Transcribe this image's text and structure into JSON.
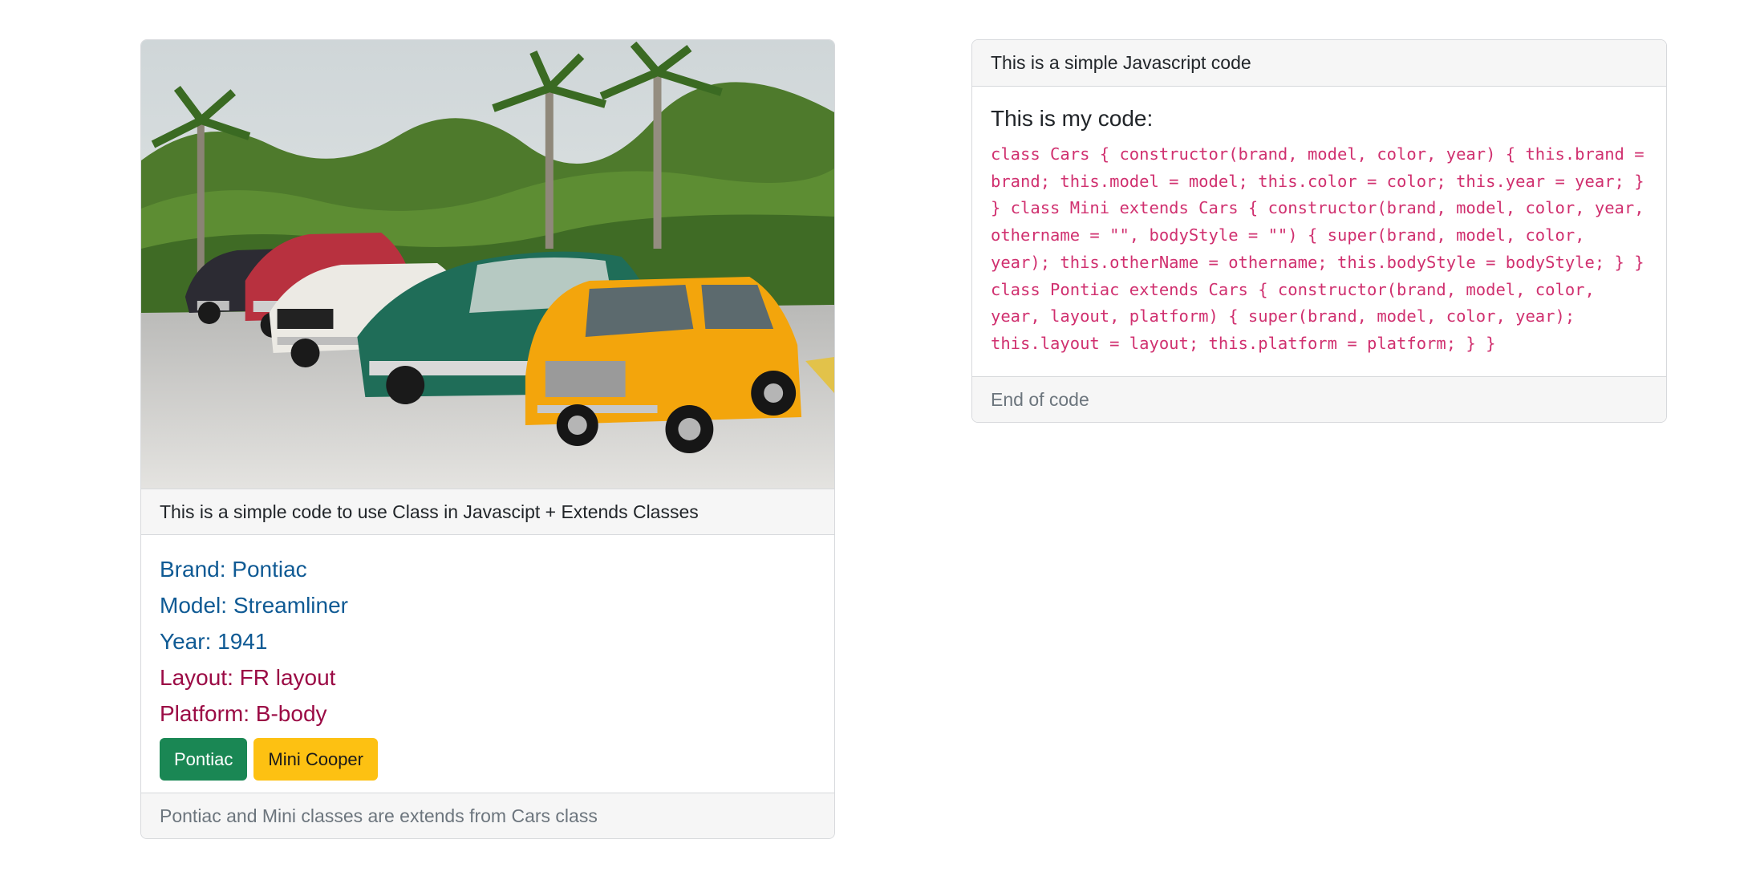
{
  "left_card": {
    "image_alt": "Classic cars lined up under palm trees",
    "header": "This is a simple code to use Class in Javascipt + Extends Classes",
    "brand": "Brand: Pontiac",
    "model": "Model: Streamliner",
    "year": "Year: 1941",
    "layout": "Layout: FR layout",
    "platform": "Platform: B-body",
    "buttons": {
      "pontiac": "Pontiac",
      "mini": "Mini Cooper"
    },
    "footer": "Pontiac and Mini classes are extends from Cars class"
  },
  "right_card": {
    "header": "This is a simple Javascript code",
    "title": "This is my code:",
    "code": "class Cars { constructor(brand, model, color, year) { this.brand = brand; this.model = model; this.color = color; this.year = year; } } class Mini extends Cars { constructor(brand, model, color, year, othername = \"\", bodyStyle = \"\") { super(brand, model, color, year); this.otherName = othername; this.bodyStyle = bodyStyle; } } class Pontiac extends Cars { constructor(brand, model, color, year, layout, platform) { super(brand, model, color, year); this.layout = layout; this.platform = platform; } }",
    "footer": "End of code"
  },
  "colors": {
    "info_blue": "#0f5a94",
    "info_red": "#9b0b45",
    "code_pink": "#d0306f",
    "btn_green": "#1a8754",
    "btn_yellow": "#fdc112"
  }
}
